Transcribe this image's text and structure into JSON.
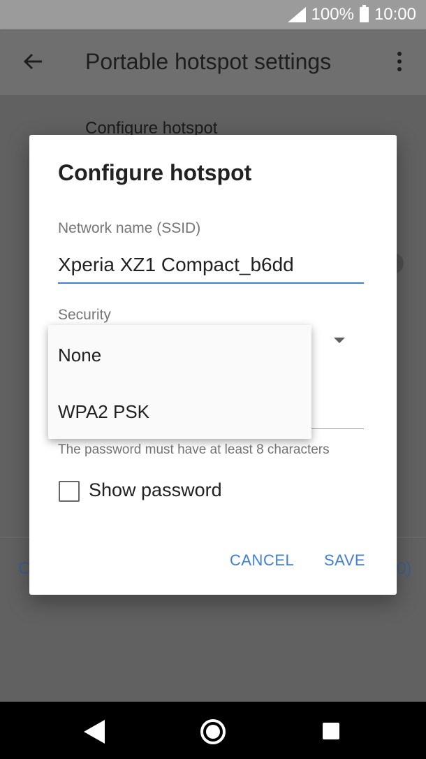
{
  "status_bar": {
    "battery": "100%",
    "time": "10:00"
  },
  "app_bar": {
    "title": "Portable hotspot settings"
  },
  "background": {
    "section_label": "Configure hotspot",
    "left_clip": "C",
    "right_clip": "0)"
  },
  "dialog": {
    "title": "Configure hotspot",
    "ssid_label": "Network name (SSID)",
    "ssid_value": "Xperia XZ1 Compact_b6dd",
    "security_label": "Security",
    "password_hint": "The password must have at least 8 characters",
    "show_password_label": "Show password",
    "show_password_checked": false,
    "cancel_label": "CANCEL",
    "save_label": "SAVE"
  },
  "dropdown": {
    "options": [
      "None",
      "WPA2 PSK"
    ]
  },
  "colors": {
    "accent": "#3f7fd6",
    "scrim": "#5f5f5f"
  }
}
